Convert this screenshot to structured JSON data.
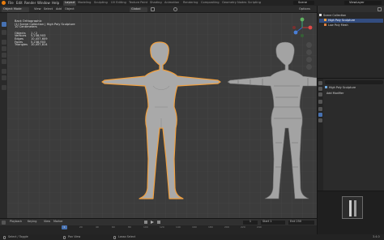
{
  "menu": [
    "File",
    "Edit",
    "Render",
    "Window",
    "Help"
  ],
  "workspaces": [
    "Layout",
    "Modeling",
    "Sculpting",
    "UV Editing",
    "Texture Paint",
    "Shading",
    "Animation",
    "Rendering",
    "Compositing",
    "Geometry Nodes",
    "Scripting"
  ],
  "active_workspace": "Layout",
  "scene": {
    "label": "Scene",
    "view_layer": "ViewLayer"
  },
  "header": {
    "mode": "Object Mode",
    "menus": [
      "View",
      "Select",
      "Add",
      "Object"
    ],
    "transform": "Global",
    "options": "Options"
  },
  "overlay_info": {
    "view": "Back Orthographic",
    "collection": "(1) Scene Collection | High Poly Sculpture",
    "units": "10 Centimeters",
    "stats": [
      {
        "label": "Objects",
        "value": "1 / 2"
      },
      {
        "label": "Vertices",
        "value": "5,238,903"
      },
      {
        "label": "Edges",
        "value": "10,457,609"
      },
      {
        "label": "Faces",
        "value": "5,238,903"
      },
      {
        "label": "Triangles",
        "value": "10,457,814"
      }
    ]
  },
  "outliner": {
    "root": "Scene Collection",
    "items": [
      "High Poly Sculpture",
      "Low Poly Mesh"
    ]
  },
  "properties": {
    "object_name": "High Poly Sculpture",
    "add_modifier": "Add Modifier"
  },
  "timeline": {
    "menus": [
      "Playback",
      "Keying",
      "View",
      "Marker"
    ],
    "current_frame": "1",
    "start_label": "Start",
    "start": "1",
    "end_label": "End",
    "end": "250",
    "ticks": [
      "0",
      "20",
      "40",
      "60",
      "80",
      "100",
      "120",
      "140",
      "160",
      "180",
      "200",
      "220",
      "240"
    ]
  },
  "status": {
    "left": "Select / Toggle",
    "middle": "Pan View",
    "right": "Lasso Select",
    "version": "3.4.0"
  },
  "colors": {
    "accent": "#4772b3",
    "selection": "#f0a040",
    "viewport": "#3c3c3c"
  }
}
